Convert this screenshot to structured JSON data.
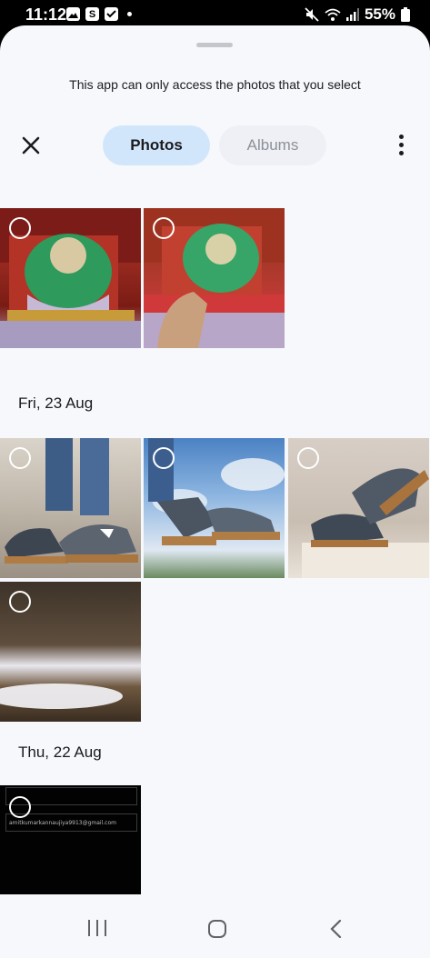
{
  "status_bar": {
    "time": "11:12",
    "battery": "55%",
    "left_icons": [
      "gallery-icon",
      "s-app-icon",
      "check-icon",
      "notification-dot"
    ],
    "right_icons": [
      "mute-icon",
      "wifi-icon",
      "signal-icon",
      "battery-icon"
    ]
  },
  "picker": {
    "notice": "This app can only access the photos that you select",
    "tabs": [
      {
        "label": "Photos",
        "selected": true
      },
      {
        "label": "Albums",
        "selected": false
      }
    ],
    "accent_color": "#d2e6fb"
  },
  "groups": [
    {
      "date": "",
      "photos": [
        "statue-photo-1",
        "statue-photo-2"
      ]
    },
    {
      "date": "Fri, 23 Aug",
      "photos": [
        "sneaker-photo-1",
        "sneaker-photo-2",
        "sneaker-photo-3",
        "dark-photo"
      ]
    },
    {
      "date": "Thu, 22 Aug",
      "photos": [
        "screenshot-photo"
      ]
    }
  ],
  "screenshot_photo": {
    "email_text": "amitkumarkannaujiya9913@gmail.com"
  },
  "nav_bar": {
    "buttons": [
      "recents-icon",
      "home-icon",
      "back-icon"
    ]
  }
}
